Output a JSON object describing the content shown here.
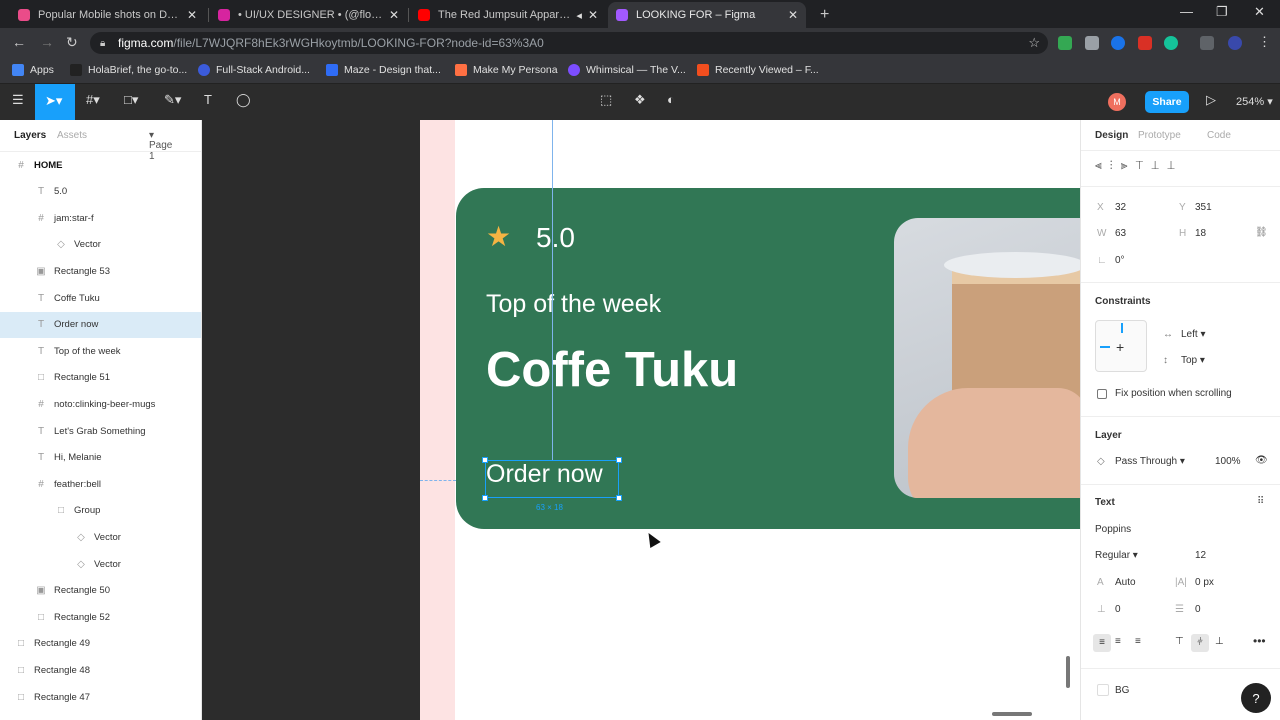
{
  "browser": {
    "tabs": [
      {
        "label": "Popular Mobile shots on Dribbble",
        "color": "#ea4c89"
      },
      {
        "label": "• UI/UX DESIGNER • (@flowie.stu",
        "color": "#d6249f"
      },
      {
        "label": "The Red Jumpsuit Apparatus",
        "color": "#ff0000"
      },
      {
        "label": "LOOKING FOR – Figma",
        "color": "#a259ff"
      }
    ],
    "url_host": "figma.com",
    "url_path": "/file/L7WJQRF8hEk3rWGHkoytmb/LOOKING-FOR?node-id=63%3A0",
    "bookmarks": [
      {
        "label": "Apps",
        "color": "#4285f4"
      },
      {
        "label": "HolaBrief, the go-to...",
        "color": "#222222"
      },
      {
        "label": "Full-Stack Android...",
        "color": "#3b5bdb"
      },
      {
        "label": "Maze - Design that...",
        "color": "#2f6cf5"
      },
      {
        "label": "Make My Persona",
        "color": "#ff7043"
      },
      {
        "label": "Whimsical — The V...",
        "color": "#7c4dff"
      },
      {
        "label": "Recently Viewed – F...",
        "color": "#f24e1e"
      }
    ]
  },
  "toolbar": {
    "avatar": "M",
    "share": "Share",
    "zoom": "254%"
  },
  "left": {
    "tab_layers": "Layers",
    "tab_assets": "Assets",
    "page": "Page 1",
    "layers": [
      {
        "label": "HOME",
        "icon": "#"
      },
      {
        "label": "5.0",
        "icon": "T"
      },
      {
        "label": "jam:star-f",
        "icon": "#"
      },
      {
        "label": "Vector",
        "icon": "◇"
      },
      {
        "label": "Rectangle 53",
        "icon": "▣"
      },
      {
        "label": "Coffe Tuku",
        "icon": "T"
      },
      {
        "label": "Order now",
        "icon": "T"
      },
      {
        "label": "Top of the week",
        "icon": "T"
      },
      {
        "label": "Rectangle 51",
        "icon": "□"
      },
      {
        "label": "noto:clinking-beer-mugs",
        "icon": "#"
      },
      {
        "label": "Let's Grab Something",
        "icon": "T"
      },
      {
        "label": "Hi, Melanie",
        "icon": "T"
      },
      {
        "label": "feather:bell",
        "icon": "#"
      },
      {
        "label": "Group",
        "icon": "□"
      },
      {
        "label": "Vector",
        "icon": "◇"
      },
      {
        "label": "Vector",
        "icon": "◇"
      },
      {
        "label": "Rectangle 50",
        "icon": "▣"
      },
      {
        "label": "Rectangle 52",
        "icon": "□"
      },
      {
        "label": "Rectangle 49",
        "icon": "□"
      },
      {
        "label": "Rectangle 48",
        "icon": "□"
      },
      {
        "label": "Rectangle 47",
        "icon": "□"
      }
    ]
  },
  "canvas": {
    "rating": "5.0",
    "subtitle": "Top of the week",
    "title": "Coffe Tuku",
    "cta": "Order now",
    "dimension": "63 × 18"
  },
  "right": {
    "tab_design": "Design",
    "tab_prototype": "Prototype",
    "tab_code": "Code",
    "x_label": "X",
    "x": "32",
    "y_label": "Y",
    "y": "351",
    "w_label": "W",
    "w": "63",
    "h_label": "H",
    "h": "18",
    "rotation": "0°",
    "constraints": "Constraints",
    "c_h": "Left",
    "c_v": "Top",
    "fix": "Fix position when scrolling",
    "layer": "Layer",
    "blend": "Pass Through",
    "opacity": "100%",
    "text": "Text",
    "font": "Poppins",
    "weight": "Regular",
    "size": "12",
    "line_height": "Auto",
    "letter_spacing": "0 px",
    "para_spacing": "0",
    "para_indent": "0",
    "bg": "BG"
  }
}
